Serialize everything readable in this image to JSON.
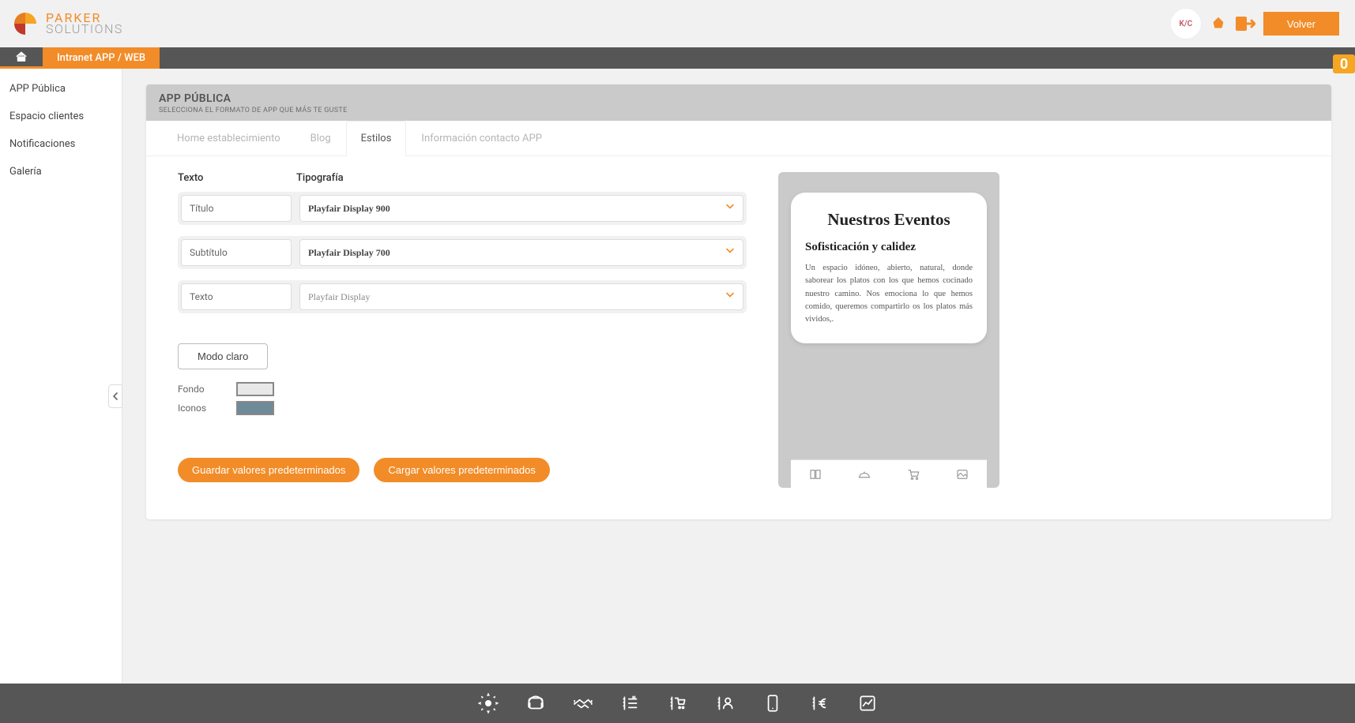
{
  "top": {
    "brand1": "PARKER",
    "brand2": "SOLUTIONS",
    "avatar_initials": "K/C",
    "back_label": "Volver"
  },
  "nav": {
    "breadcrumb": "Intranet APP / WEB",
    "badge": "0"
  },
  "sidebar": {
    "items": [
      {
        "label": "APP Pública"
      },
      {
        "label": "Espacio clientes"
      },
      {
        "label": "Notificaciones"
      },
      {
        "label": "Galería"
      }
    ]
  },
  "panel": {
    "title": "APP PÚBLICA",
    "subtitle": "SELECCIONA EL FORMATO DE APP QUE MÁS TE GUSTE"
  },
  "tabs": [
    {
      "label": "Home establecimiento"
    },
    {
      "label": "Blog"
    },
    {
      "label": "Estilos",
      "active": true
    },
    {
      "label": "Información contacto APP"
    }
  ],
  "form": {
    "col_text": "Texto",
    "col_typo": "Tipografía",
    "rows": [
      {
        "label": "Título",
        "value": "Playfair Display 900"
      },
      {
        "label": "Subtítulo",
        "value": "Playfair Display 700"
      },
      {
        "label": "Texto",
        "value": "Playfair Display"
      }
    ],
    "mode_btn": "Modo claro",
    "swatches": [
      {
        "label": "Fondo",
        "color": "#e8e8e8"
      },
      {
        "label": "Iconos",
        "color": "#6f8a99"
      }
    ],
    "save_btn": "Guardar valores predeterminados",
    "load_btn": "Cargar valores predeterminados"
  },
  "preview": {
    "title": "Nuestros Eventos",
    "subtitle": "Sofisticación y calidez",
    "body": "Un espacio idóneo, abierto, natural, donde saborear los platos con los que hemos cocinado nuestro camino. Nos emociona lo que hemos comido, queremos compartirlo os los platos más vividos,."
  }
}
